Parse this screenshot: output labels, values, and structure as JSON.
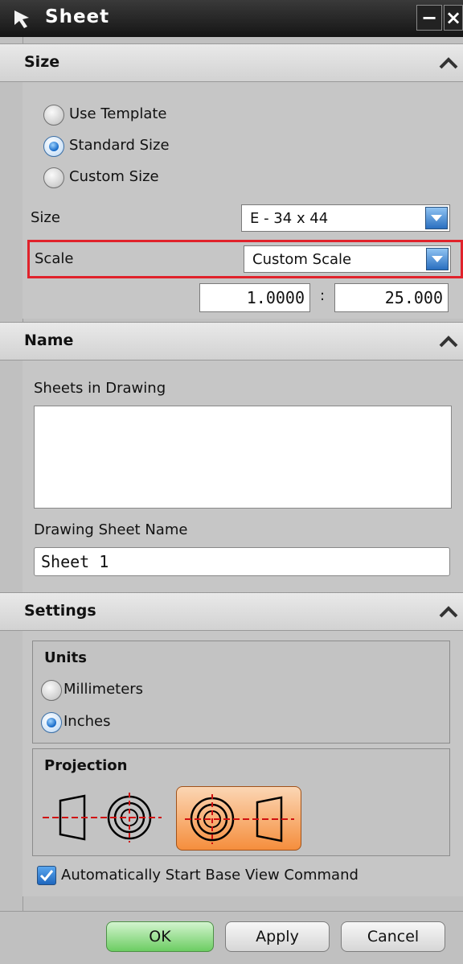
{
  "window": {
    "title": "Sheet"
  },
  "size_section": {
    "header": "Size",
    "options": [
      "Use Template",
      "Standard Size",
      "Custom Size"
    ],
    "selected_option": "Standard Size",
    "size_label": "Size",
    "size_value": "E - 34 x 44",
    "scale_label": "Scale",
    "scale_value": "Custom Scale",
    "scale_numerator": "1.0000",
    "scale_separator": ":",
    "scale_denominator": "25.000"
  },
  "name_section": {
    "header": "Name",
    "sheets_label": "Sheets in Drawing",
    "sheet_name_label": "Drawing Sheet Name",
    "sheet_name_value": "Sheet 1"
  },
  "settings_section": {
    "header": "Settings",
    "units_label": "Units",
    "units_options": [
      "Millimeters",
      "Inches"
    ],
    "units_selected": "Inches",
    "projection_label": "Projection",
    "projection_options": [
      "first-angle-projection-icon",
      "third-angle-projection-icon"
    ],
    "projection_selected": "third-angle-projection-icon",
    "auto_start_label": "Automatically Start Base View Command",
    "auto_start_checked": true
  },
  "buttons": {
    "ok": "OK",
    "apply": "Apply",
    "cancel": "Cancel"
  },
  "colors": {
    "highlight_box": "#e0222b",
    "ok_green": "#6ccd62",
    "selected_projection": "#f59a52",
    "dropdown_blue": "#2a6fc0"
  }
}
